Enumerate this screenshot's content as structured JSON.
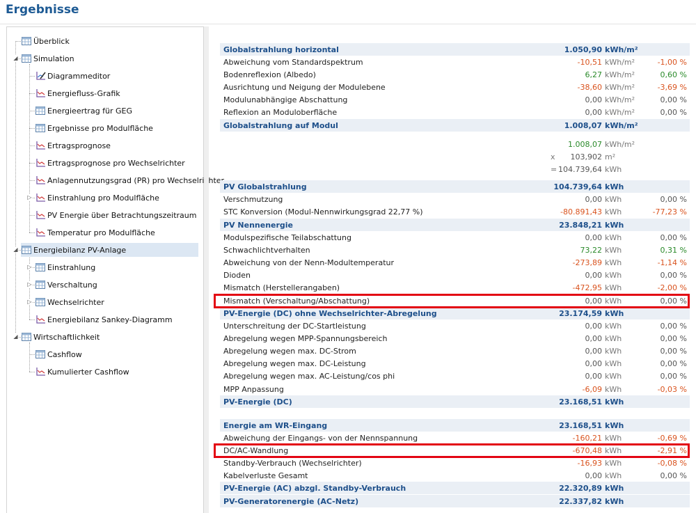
{
  "page": {
    "title": "Ergebnisse"
  },
  "tree": [
    {
      "label": "Überblick"
    },
    {
      "label": "Simulation"
    },
    {
      "label": "Diagrammeditor"
    },
    {
      "label": "Energiefluss-Grafik"
    },
    {
      "label": "Energieertrag für GEG"
    },
    {
      "label": "Ergebnisse pro Modulfläche"
    },
    {
      "label": "Ertragsprognose"
    },
    {
      "label": "Ertragsprognose pro Wechselrichter"
    },
    {
      "label": "Anlagennutzungsgrad (PR) pro Wechselrichter"
    },
    {
      "label": "Einstrahlung pro Modulfläche"
    },
    {
      "label": "PV Energie über Betrachtungszeitraum"
    },
    {
      "label": "Temperatur pro Modulfläche"
    },
    {
      "label": "Energiebilanz PV-Anlage"
    },
    {
      "label": "Einstrahlung"
    },
    {
      "label": "Verschaltung"
    },
    {
      "label": "Wechselrichter"
    },
    {
      "label": "Energiebilanz Sankey-Diagramm"
    },
    {
      "label": "Wirtschaftlichkeit"
    },
    {
      "label": "Cashflow"
    },
    {
      "label": "Kumulierter Cashflow"
    }
  ],
  "results": {
    "rows": [
      {
        "label": "Globalstrahlung horizontal",
        "value": "1.050,90",
        "unit": "kWh/m²",
        "pct": ""
      },
      {
        "label": "Abweichung vom Standardspektrum",
        "value": "-10,51",
        "unit": "kWh/m²",
        "pct": "-1,00 %"
      },
      {
        "label": "Bodenreflexion (Albedo)",
        "value": "6,27",
        "unit": "kWh/m²",
        "pct": "0,60 %"
      },
      {
        "label": "Ausrichtung und Neigung der Modulebene",
        "value": "-38,60",
        "unit": "kWh/m²",
        "pct": "-3,69 %"
      },
      {
        "label": "Modulunabhängige Abschattung",
        "value": "0,00",
        "unit": "kWh/m²",
        "pct": "0,00 %"
      },
      {
        "label": "Reflexion an Moduloberfläche",
        "value": "0,00",
        "unit": "kWh/m²",
        "pct": "0,00 %"
      },
      {
        "label": "Globalstrahlung auf Modul",
        "value": "1.008,07",
        "unit": "kWh/m²",
        "pct": ""
      },
      {
        "label": "PV Globalstrahlung",
        "value": "104.739,64",
        "unit": "kWh",
        "pct": ""
      },
      {
        "label": "Verschmutzung",
        "value": "0,00",
        "unit": "kWh",
        "pct": "0,00 %"
      },
      {
        "label": "STC Konversion (Modul-Nennwirkungsgrad 22,77 %)",
        "value": "-80.891,43",
        "unit": "kWh",
        "pct": "-77,23 %"
      },
      {
        "label": "PV Nennenergie",
        "value": "23.848,21",
        "unit": "kWh",
        "pct": ""
      },
      {
        "label": "Modulspezifische Teilabschattung",
        "value": "0,00",
        "unit": "kWh",
        "pct": "0,00 %"
      },
      {
        "label": "Schwachlichtverhalten",
        "value": "73,22",
        "unit": "kWh",
        "pct": "0,31 %"
      },
      {
        "label": "Abweichung von der Nenn-Modultemperatur",
        "value": "-273,89",
        "unit": "kWh",
        "pct": "-1,14 %"
      },
      {
        "label": "Dioden",
        "value": "0,00",
        "unit": "kWh",
        "pct": "0,00 %"
      },
      {
        "label": "Mismatch (Herstellerangaben)",
        "value": "-472,95",
        "unit": "kWh",
        "pct": "-2,00 %"
      },
      {
        "label": "Mismatch (Verschaltung/Abschattung)",
        "value": "0,00",
        "unit": "kWh",
        "pct": "0,00 %"
      },
      {
        "label": "PV-Energie (DC) ohne Wechselrichter-Abregelung",
        "value": "23.174,59",
        "unit": "kWh",
        "pct": ""
      },
      {
        "label": "Unterschreitung der DC-Startleistung",
        "value": "0,00",
        "unit": "kWh",
        "pct": "0,00 %"
      },
      {
        "label": "Abregelung wegen MPP-Spannungsbereich",
        "value": "0,00",
        "unit": "kWh",
        "pct": "0,00 %"
      },
      {
        "label": "Abregelung wegen max. DC-Strom",
        "value": "0,00",
        "unit": "kWh",
        "pct": "0,00 %"
      },
      {
        "label": "Abregelung wegen max. DC-Leistung",
        "value": "0,00",
        "unit": "kWh",
        "pct": "0,00 %"
      },
      {
        "label": "Abregelung wegen max. AC-Leistung/cos phi",
        "value": "0,00",
        "unit": "kWh",
        "pct": "0,00 %"
      },
      {
        "label": "MPP Anpassung",
        "value": "-6,09",
        "unit": "kWh",
        "pct": "-0,03 %"
      },
      {
        "label": "PV-Energie (DC)",
        "value": "23.168,51",
        "unit": "kWh",
        "pct": ""
      },
      {
        "label": "Energie am WR-Eingang",
        "value": "23.168,51",
        "unit": "kWh",
        "pct": ""
      },
      {
        "label": "Abweichung der Eingangs- von der Nennspannung",
        "value": "-160,21",
        "unit": "kWh",
        "pct": "-0,69 %"
      },
      {
        "label": "DC/AC-Wandlung",
        "value": "-670,48",
        "unit": "kWh",
        "pct": "-2,91 %"
      },
      {
        "label": "Standby-Verbrauch (Wechselrichter)",
        "value": "-16,93",
        "unit": "kWh",
        "pct": "-0,08 %"
      },
      {
        "label": "Kabelverluste Gesamt",
        "value": "0,00",
        "unit": "kWh",
        "pct": "0,00 %"
      },
      {
        "label": "PV-Energie (AC) abzgl. Standby-Verbrauch",
        "value": "22.320,89",
        "unit": "kWh",
        "pct": ""
      },
      {
        "label": "PV-Generatorenergie (AC-Netz)",
        "value": "22.337,82",
        "unit": "kWh",
        "pct": ""
      }
    ],
    "calc": [
      {
        "op": "",
        "value": "1.008,07",
        "unit": "kWh/m²"
      },
      {
        "op": "x",
        "value": "103,902",
        "unit": "m²"
      },
      {
        "op": "=",
        "value": "104.739,64",
        "unit": "kWh"
      }
    ]
  },
  "colors": {
    "accent": "#1d4f8a",
    "negative": "#d9531e",
    "positive": "#2a8a2a",
    "highlight": "#e30613",
    "section_bg": "#eaeff5",
    "selected_bg": "#dce7f3"
  }
}
